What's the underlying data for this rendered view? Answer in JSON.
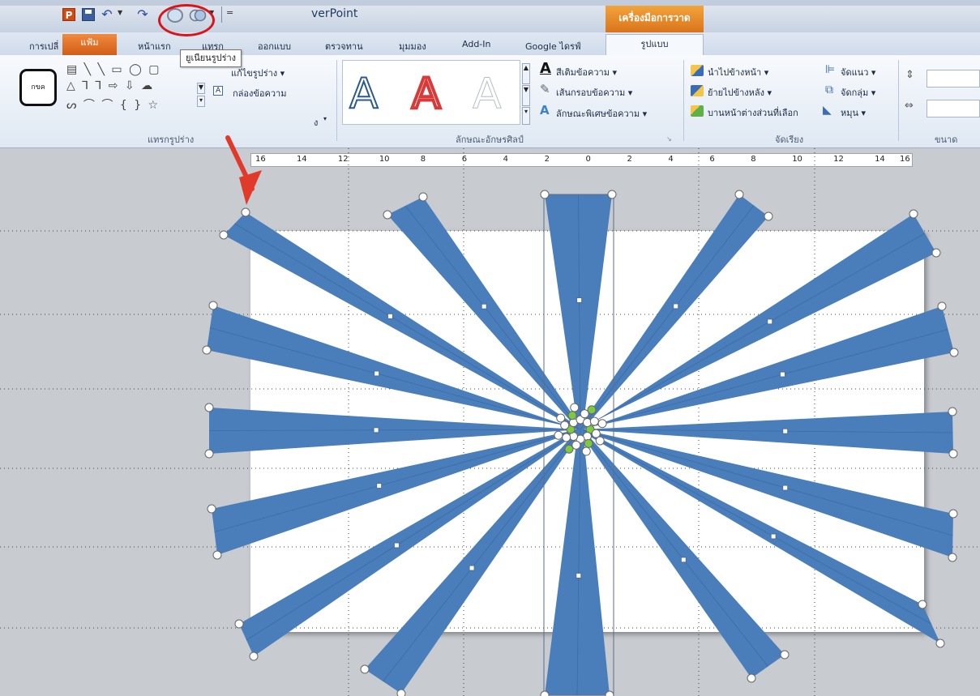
{
  "window": {
    "title": "PowerPoint",
    "title_visible_fragment": "verPoint",
    "context_group": "เครื่องมือการวาด"
  },
  "quick_access": {
    "logo_letter": "P",
    "more": "="
  },
  "tabs": {
    "transition": "การเปลี่",
    "file": "แฟ้ม",
    "home": "หน้าแรก",
    "insert": "แทรก",
    "design": "ออกแบบ",
    "review": "ตรวจทาน",
    "view": "มุมมอง",
    "addin": "Add-In",
    "google": "Google ไดรฟ์",
    "format": "รูปแบบ"
  },
  "tooltip": "ยูเนียนรูปร่าง",
  "ribbon": {
    "insert_shapes": {
      "label": "แทรกรูปร่าง",
      "edit_shape_preview": "กขค",
      "edit_shape": "แก้ไขรูปร่าง",
      "text_box": "กล่องข้อความ",
      "merge_fragment": "ง"
    },
    "wordart": {
      "label": "ลักษณะอักษรศิลป์",
      "styles": [
        "A",
        "A",
        "A"
      ],
      "text_fill": "สีเติมข้อความ",
      "text_outline": "เส้นกรอบข้อความ",
      "text_effects": "ลักษณะพิเศษข้อความ"
    },
    "arrange": {
      "label": "จัดเรียง",
      "bring_forward": "นำไปข้างหน้า",
      "send_backward": "ย้ายไปข้างหลัง",
      "selection_pane": "บานหน้าต่างส่วนที่เลือก",
      "align": "จัดแนว",
      "group": "จัดกลุ่ม",
      "rotate": "หมุน"
    },
    "size": {
      "label": "ขนาด"
    }
  },
  "ruler": {
    "labels": [
      "16",
      "14",
      "12",
      "10",
      "8",
      "6",
      "4",
      "2",
      "0",
      "2",
      "4",
      "6",
      "8",
      "10",
      "12",
      "14",
      "16"
    ]
  },
  "colors": {
    "ray": "#4a7ebb",
    "accent_orange": "#e8741f",
    "annotation_red": "#e03a2a"
  },
  "icons": {
    "undo": "undo-icon",
    "redo": "redo-icon",
    "union": "union-shapes-icon",
    "combine": "combine-shapes-icon"
  }
}
